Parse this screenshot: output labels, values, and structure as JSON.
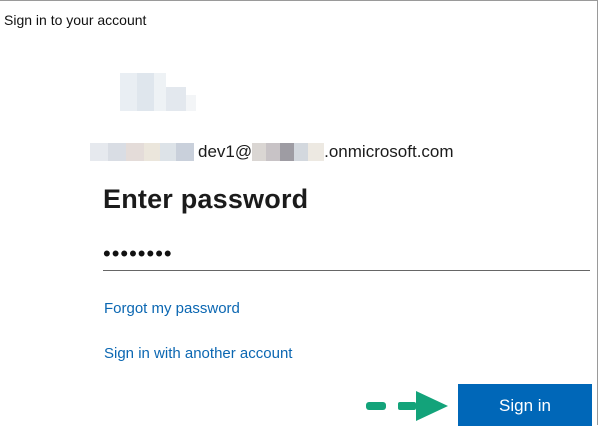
{
  "window": {
    "title": "Sign in to your account"
  },
  "account": {
    "email_visible_part_1": "dev1@",
    "email_visible_part_2": ".onmicrosoft.com"
  },
  "form": {
    "heading": "Enter password",
    "password_value": "••••••••"
  },
  "links": {
    "forgot_password": "Forgot my password",
    "other_account": "Sign in with another account"
  },
  "actions": {
    "sign_in_label": "Sign in"
  },
  "colors": {
    "primary_button": "#0067b8",
    "link": "#0b67b2",
    "annotation_arrow": "#13a37a"
  },
  "icons": {
    "logo": "redacted-logo-icon",
    "annotation": "arrow-right-icon"
  }
}
